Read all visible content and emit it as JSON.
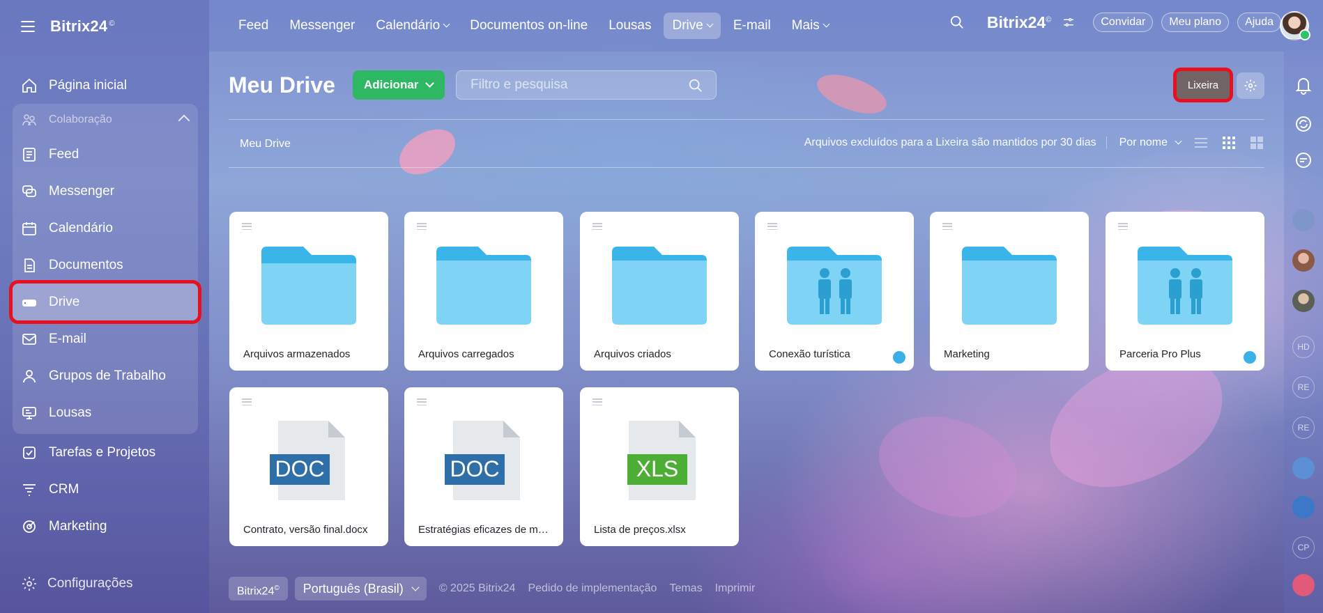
{
  "app": {
    "brand": "Bitrix24",
    "brand_mark": "©"
  },
  "sidebar": {
    "items_top": [
      {
        "label": "Página inicial",
        "icon": "home-icon"
      }
    ],
    "group": {
      "label": "Colaboração",
      "items": [
        {
          "label": "Feed",
          "icon": "feed-icon"
        },
        {
          "label": "Messenger",
          "icon": "messenger-icon"
        },
        {
          "label": "Calendário",
          "icon": "calendar-icon"
        },
        {
          "label": "Documentos",
          "icon": "documents-icon"
        },
        {
          "label": "Drive",
          "icon": "drive-icon",
          "active": true
        },
        {
          "label": "E-mail",
          "icon": "email-icon"
        },
        {
          "label": "Grupos de Trabalho",
          "icon": "workgroups-icon"
        },
        {
          "label": "Lousas",
          "icon": "boards-icon"
        }
      ]
    },
    "items_bottom": [
      {
        "label": "Tarefas e Projetos",
        "icon": "tasks-icon"
      },
      {
        "label": "CRM",
        "icon": "crm-icon"
      },
      {
        "label": "Marketing",
        "icon": "marketing-icon"
      }
    ],
    "settings_label": "Configurações"
  },
  "topnav": {
    "tabs": [
      {
        "label": "Feed"
      },
      {
        "label": "Messenger"
      },
      {
        "label": "Calendário",
        "dropdown": true
      },
      {
        "label": "Documentos on-line"
      },
      {
        "label": "Lousas"
      },
      {
        "label": "Drive",
        "dropdown": true,
        "active": true
      },
      {
        "label": "E-mail"
      },
      {
        "label": "Mais",
        "dropdown": true
      }
    ],
    "invite_label": "Convidar",
    "plan_label": "Meu plano",
    "help_label": "Ajuda"
  },
  "main": {
    "title": "Meu Drive",
    "add_label": "Adicionar",
    "search_placeholder": "Filtro e pesquisa",
    "trash_label": "Lixeira",
    "breadcrumb": "Meu Drive",
    "trash_note": "Arquivos excluídos para a Lixeira são mantidos por 30 dias",
    "sort_label": "Por nome"
  },
  "items": [
    {
      "name": "Arquivos armazenados",
      "type": "folder",
      "shared": false
    },
    {
      "name": "Arquivos carregados",
      "type": "folder",
      "shared": false
    },
    {
      "name": "Arquivos criados",
      "type": "folder",
      "shared": false
    },
    {
      "name": "Conexão turística",
      "type": "group-folder",
      "shared": true
    },
    {
      "name": "Marketing",
      "type": "folder",
      "shared": false
    },
    {
      "name": "Parceria Pro Plus",
      "type": "group-folder",
      "shared": true
    },
    {
      "name": "Contrato, versão final.docx",
      "type": "doc",
      "badge": "DOC"
    },
    {
      "name": "Estratégias eficazes de ma...",
      "type": "doc",
      "badge": "DOC"
    },
    {
      "name": "Lista de preços.xlsx",
      "type": "xls",
      "badge": "XLS"
    }
  ],
  "footer": {
    "brand": "Bitrix24",
    "language": "Português (Brasil)",
    "copyright": "© 2025 Bitrix24",
    "links": [
      "Pedido de implementação",
      "Temas",
      "Imprimir"
    ]
  },
  "rail": {
    "avatar_initials": [
      "HD",
      "RE",
      "RE",
      "CP"
    ]
  },
  "colors": {
    "accent_green": "#2fb864",
    "folder_blue": "#7fd3f5",
    "doc_blue": "#2f6fa8",
    "xls_green": "#4cae34",
    "highlight_red": "#e8101f"
  }
}
